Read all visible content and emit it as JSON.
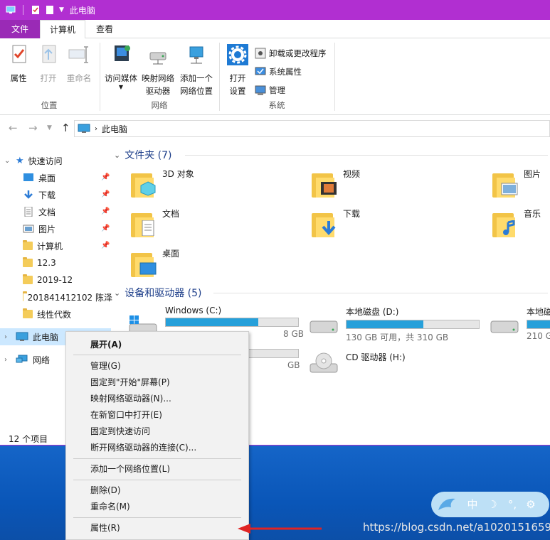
{
  "window": {
    "title": "此电脑"
  },
  "ribbon": {
    "tabs": [
      "文件",
      "计算机",
      "查看"
    ],
    "location_group": {
      "label": "位置",
      "buttons": [
        "属性",
        "打开",
        "重命名"
      ]
    },
    "network_group": {
      "label": "网络",
      "buttons": [
        "访问媒体",
        "映射网络",
        "驱动器",
        "添加一个",
        "网络位置"
      ]
    },
    "system_group": {
      "label": "系统",
      "open_settings": [
        "打开",
        "设置"
      ],
      "small": [
        "卸载或更改程序",
        "系统属性",
        "管理"
      ]
    }
  },
  "address": {
    "path": "此电脑"
  },
  "nav": {
    "quick_access": "快速访问",
    "items": [
      "桌面",
      "下载",
      "文档",
      "图片",
      "计算机",
      "12.3",
      "2019-12",
      "201841412102 陈泽",
      "线性代数"
    ],
    "this_pc": "此电脑",
    "network": "网络"
  },
  "content": {
    "folders_header": "文件夹 (7)",
    "folders": [
      "3D 对象",
      "视频",
      "图片",
      "文档",
      "下载",
      "音乐",
      "桌面"
    ],
    "drives_header": "设备和驱动器 (5)",
    "drives": [
      {
        "name": "Windows (C:)",
        "size": "8 GB",
        "fill": 0.7
      },
      {
        "name": "本地磁盘 (D:)",
        "size": "130 GB 可用，共 310 GB",
        "fill": 0.58
      },
      {
        "name": "本地磁",
        "size": "210 G",
        "fill": 0.55
      },
      {
        "name": "",
        "size": "GB",
        "fill": 0
      },
      {
        "name": "CD 驱动器 (H:)",
        "size": "",
        "fill": 0
      }
    ]
  },
  "status": {
    "items": "12 个项目"
  },
  "context_menu": {
    "items": [
      "展开(A)",
      "管理(G)",
      "固定到\"开始\"屏幕(P)",
      "映射网络驱动器(N)...",
      "在新窗口中打开(E)",
      "固定到快速访问",
      "断开网络驱动器的连接(C)...",
      "添加一个网络位置(L)",
      "删除(D)",
      "重命名(M)",
      "属性(R)"
    ]
  },
  "widget": {
    "label": "中"
  },
  "watermark": "https://blog.csdn.net/a10201516595",
  "colors": {
    "accent": "#b12fd1",
    "file_tab": "#9a2ab6",
    "drive_bar": "#26a0da",
    "arrow": "#e02424"
  }
}
